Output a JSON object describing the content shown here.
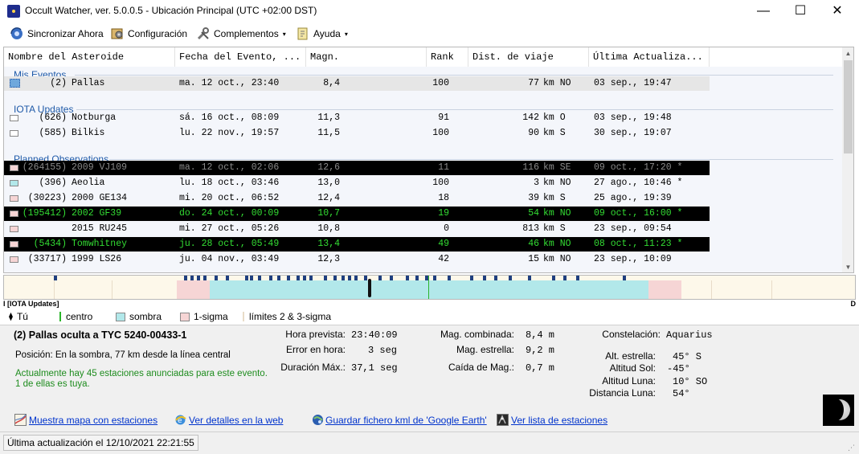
{
  "window": {
    "title": "Occult Watcher, ver. 5.0.0.5 - Ubicación Principal (UTC +02:00 DST)",
    "controls": {
      "minimize": "—",
      "maximize": "☐",
      "close": "✕"
    }
  },
  "menu": {
    "sync": "Sincronizar Ahora",
    "config": "Configuración",
    "plugins": "Complementos",
    "help": "Ayuda",
    "caret": "▾"
  },
  "columns": {
    "asteroid": "Nombre del Asteroide",
    "date": "Fecha del Evento, ...",
    "mag": "Magn.",
    "rank": "Rank",
    "dist": "Dist. de viaje",
    "updated": "Última Actualiza..."
  },
  "groups": {
    "mine": "Mis Eventos",
    "iota": "IOTA Updates",
    "planned": "Planned Observations"
  },
  "events": [
    {
      "num": "(2)",
      "name": "Pallas",
      "date": "ma. 12 oct., 23:40",
      "mag": "8,4",
      "rank": "100",
      "dist": "77",
      "dir": "km NO",
      "updated": "03 sep., 19:47",
      "style": "selected",
      "flag": "#6fa8dc"
    },
    {
      "num": "(626)",
      "name": "Notburga",
      "date": "sá. 16 oct., 08:09",
      "mag": "11,3",
      "rank": "91",
      "dist": "142",
      "dir": "km O",
      "updated": "03 sep., 19:48",
      "style": "normal",
      "flag": "#ffffff"
    },
    {
      "num": "(585)",
      "name": "Bilkis",
      "date": "lu. 22 nov., 19:57",
      "mag": "11,5",
      "rank": "100",
      "dist": "90",
      "dir": "km S",
      "updated": "30 sep., 19:07",
      "style": "normal",
      "flag": "#ffffff"
    },
    {
      "num": "(264155)",
      "name": "2009 VJ109",
      "date": "ma. 12 oct., 02:06",
      "mag": "12,6",
      "rank": "11",
      "dist": "116",
      "dir": "km SE",
      "updated": "09 oct., 17:20 *",
      "style": "dark-grey",
      "flag": "#f6d5d5"
    },
    {
      "num": "(396)",
      "name": "Aeolia",
      "date": "lu. 18 oct., 03:46",
      "mag": "13,0",
      "rank": "100",
      "dist": "3",
      "dir": "km NO",
      "updated": "27 ago., 10:46 *",
      "style": "normal",
      "flag": "#b2e8ea"
    },
    {
      "num": "(30223)",
      "name": "2000 GE134",
      "date": "mi. 20 oct., 06:52",
      "mag": "12,4",
      "rank": "18",
      "dist": "39",
      "dir": "km S",
      "updated": "25 ago., 19:39",
      "style": "normal",
      "flag": "#f6d5d5"
    },
    {
      "num": "(195412)",
      "name": "2002 GF39",
      "date": "do. 24 oct., 00:09",
      "mag": "10,7",
      "rank": "19",
      "dist": "54",
      "dir": "km NO",
      "updated": "09 oct., 16:00 *",
      "style": "dark-green",
      "flag": "#f6d5d5"
    },
    {
      "num": "",
      "name": "2015 RU245",
      "date": "mi. 27 oct., 05:26",
      "mag": "10,8",
      "rank": "0",
      "dist": "813",
      "dir": "km S",
      "updated": "23 sep., 09:54",
      "style": "normal",
      "flag": "#f6d5d5"
    },
    {
      "num": "(5434)",
      "name": "Tomwhitney",
      "date": "ju. 28 oct., 05:49",
      "mag": "13,4",
      "rank": "49",
      "dist": "46",
      "dir": "km NO",
      "updated": "08 oct., 11:23 *",
      "style": "dark-green",
      "flag": "#f6d5d5"
    },
    {
      "num": "(33717)",
      "name": "1999 LS26",
      "date": "ju. 04 nov., 03:49",
      "mag": "12,3",
      "rank": "42",
      "dist": "15",
      "dir": "km NO",
      "updated": "23 sep., 10:09",
      "style": "normal",
      "flag": "#f6d5d5"
    }
  ],
  "scrollbar": {
    "up": "▲",
    "down": "▼"
  },
  "timeline": {
    "left_label": "I [IOTA Updates]",
    "right_label": "D"
  },
  "legend": {
    "you": "Tú",
    "centre": "centro",
    "shadow": "sombra",
    "sigma1": "1-sigma",
    "sigma23": "límites 2 & 3-sigma",
    "you_marker": "⧫",
    "colors": {
      "centre": "#2bb52b",
      "shadow": "#b2e8ea",
      "sigma1": "#f6d5d5",
      "sigma23": "#e8dcc8"
    }
  },
  "details": {
    "title": "(2) Pallas oculta a TYC 5240-00433-1",
    "position_label": "Posición:",
    "position_value": "En la sombra, 77 km desde la línea central",
    "stations_line1": "Actualmente hay 45 estaciones anunciadas para este evento.",
    "stations_line2": "1 de ellas es tuya.",
    "time_label": "Hora prevista:",
    "time_value": "23:40:09",
    "error_label": "Error en hora:",
    "error_value": "3 seg",
    "duration_label": "Duración Máx.:",
    "duration_value": "37,1 seg",
    "magcomb_label": "Mag. combinada:",
    "magcomb_value": "8,4 m",
    "magstar_label": "Mag. estrella:",
    "magstar_value": "9,2 m",
    "magdrop_label": "Caída de Mag.:",
    "magdrop_value": "0,7 m",
    "const_label": "Constelación:",
    "const_value": "Aquarius",
    "altstar_label": "Alt. estrella:",
    "altstar_value": "45° S",
    "altsun_label": "Altitud Sol:",
    "altsun_value": "-45°",
    "altmoon_label": "Altitud Luna:",
    "altmoon_value": "10° SO",
    "distmoon_label": "Distancia Luna:",
    "distmoon_value": "54°"
  },
  "links": {
    "map": "Muestra mapa con estaciones",
    "web": "Ver detalles en la web",
    "kml": "Guardar fichero kml de 'Google Earth'",
    "stations": "Ver lista de estaciones"
  },
  "status": {
    "text": "Última actualización el 12/10/2021 22:21:55",
    "grip": "⋰"
  }
}
